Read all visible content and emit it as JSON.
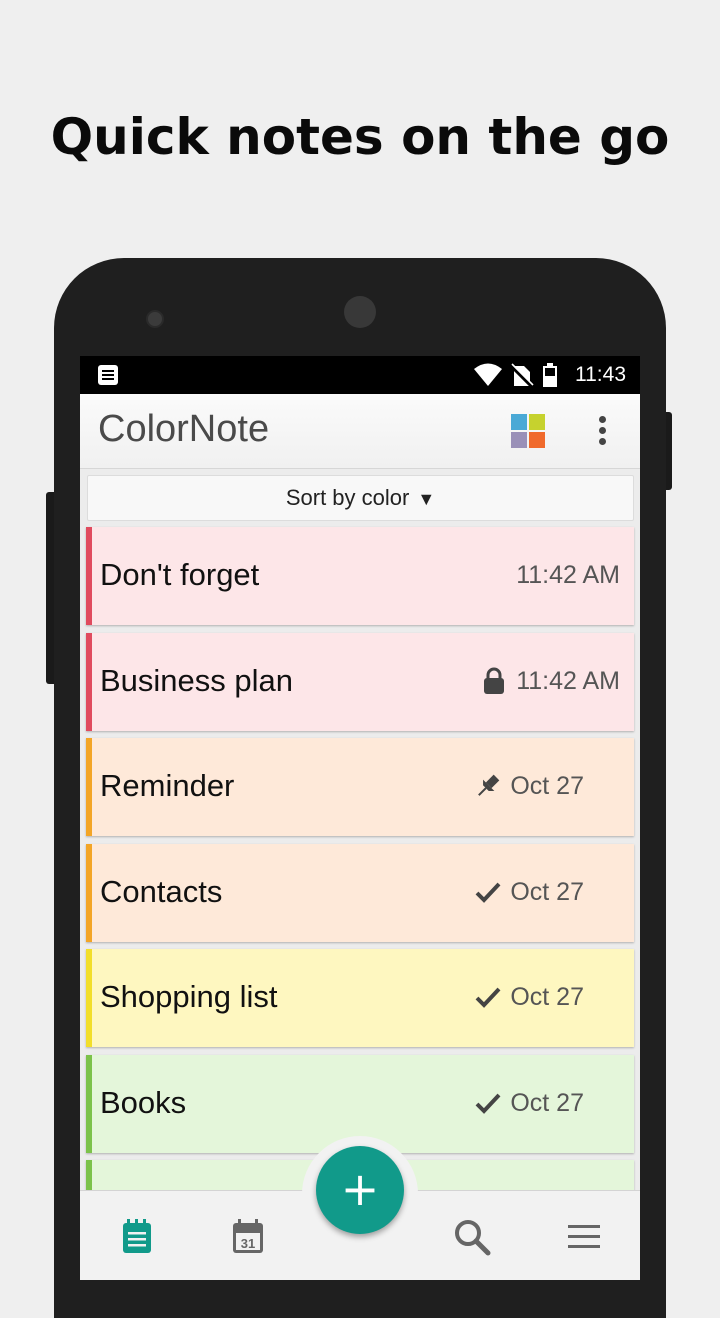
{
  "headline": "Quick notes on the go",
  "status_bar": {
    "time": "11:43",
    "icons": [
      "notification-icon",
      "wifi-icon",
      "no-sim-icon",
      "battery-icon"
    ]
  },
  "app": {
    "name": "ColorNote",
    "actions": [
      "color-grid-icon",
      "overflow-menu-icon"
    ],
    "colors": {
      "teal": "#119a8a",
      "grid_yellow": "#c6d22e",
      "grid_blue": "#4aa9d6",
      "grid_purple": "#9a90b8",
      "grid_orange": "#f06a2c"
    }
  },
  "sort": {
    "label": "Sort by color",
    "arrow": "▼"
  },
  "notes": [
    {
      "title": "Don't forget",
      "date": "11:42 AM",
      "icon": "",
      "bg": "#fde6e8",
      "bar": "#e04b5e"
    },
    {
      "title": "Business plan",
      "date": "11:42 AM",
      "icon": "lock-icon",
      "bg": "#fde6e8",
      "bar": "#e04b5e"
    },
    {
      "title": "Reminder",
      "date": "Oct 27",
      "icon": "pin-icon",
      "bg": "#fee9d9",
      "bar": "#f3a526"
    },
    {
      "title": "Contacts",
      "date": "Oct 27",
      "icon": "check-icon",
      "bg": "#fee9d9",
      "bar": "#f3a526"
    },
    {
      "title": "Shopping list",
      "date": "Oct 27",
      "icon": "check-icon",
      "bg": "#fef7c0",
      "bar": "#f2de2a"
    },
    {
      "title": "Books",
      "date": "Oct 27",
      "icon": "check-icon",
      "bg": "#e4f6da",
      "bar": "#7cc24a"
    },
    {
      "title": "",
      "date": "",
      "icon": "",
      "bg": "#e4f6da",
      "bar": "#7cc24a"
    }
  ],
  "fab": {
    "label": "+"
  },
  "bottom_nav": {
    "items": [
      "notes-icon",
      "calendar-icon",
      "search-icon",
      "menu-icon"
    ],
    "calendar_day": "31",
    "active_color": "#119a8a",
    "inactive_color": "#666666"
  }
}
